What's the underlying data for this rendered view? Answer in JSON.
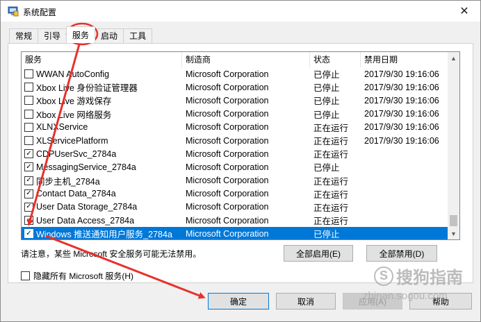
{
  "window": {
    "title": "系统配置",
    "close": "✕"
  },
  "tabs": [
    "常规",
    "引导",
    "服务",
    "启动",
    "工具"
  ],
  "table": {
    "headers": [
      "服务",
      "制造商",
      "状态",
      "禁用日期"
    ],
    "rows": [
      {
        "checked": false,
        "name": "WWAN AutoConfig",
        "maker": "Microsoft Corporation",
        "status": "已停止",
        "date": "2017/9/30 19:16:06"
      },
      {
        "checked": false,
        "name": "Xbox Live 身份验证管理器",
        "maker": "Microsoft Corporation",
        "status": "已停止",
        "date": "2017/9/30 19:16:06"
      },
      {
        "checked": false,
        "name": "Xbox Live 游戏保存",
        "maker": "Microsoft Corporation",
        "status": "已停止",
        "date": "2017/9/30 19:16:06"
      },
      {
        "checked": false,
        "name": "Xbox Live 网络服务",
        "maker": "Microsoft Corporation",
        "status": "已停止",
        "date": "2017/9/30 19:16:06"
      },
      {
        "checked": false,
        "name": "XLNXService",
        "maker": "Microsoft Corporation",
        "status": "正在运行",
        "date": "2017/9/30 19:16:06"
      },
      {
        "checked": false,
        "name": "XLServicePlatform",
        "maker": "Microsoft Corporation",
        "status": "正在运行",
        "date": "2017/9/30 19:16:06"
      },
      {
        "checked": true,
        "name": "CDPUserSvc_2784a",
        "maker": "Microsoft Corporation",
        "status": "正在运行",
        "date": ""
      },
      {
        "checked": true,
        "name": "MessagingService_2784a",
        "maker": "Microsoft Corporation",
        "status": "已停止",
        "date": ""
      },
      {
        "checked": true,
        "name": "同步主机_2784a",
        "maker": "Microsoft Corporation",
        "status": "正在运行",
        "date": ""
      },
      {
        "checked": true,
        "name": "Contact Data_2784a",
        "maker": "Microsoft Corporation",
        "status": "正在运行",
        "date": ""
      },
      {
        "checked": true,
        "name": "User Data Storage_2784a",
        "maker": "Microsoft Corporation",
        "status": "正在运行",
        "date": ""
      },
      {
        "checked": true,
        "name": "User Data Access_2784a",
        "maker": "Microsoft Corporation",
        "status": "正在运行",
        "date": ""
      },
      {
        "checked": true,
        "name": "Windows 推送通知用户服务_2784a",
        "maker": "Microsoft Corporation",
        "status": "已停止",
        "date": "",
        "selected": true
      }
    ]
  },
  "notice": "请注意，某些 Microsoft 安全服务可能无法禁用。",
  "buttons": {
    "enable_all": "全部启用(E)",
    "disable_all": "全部禁用(D)",
    "ok": "确定",
    "cancel": "取消",
    "apply": "应用(A)",
    "help": "帮助"
  },
  "hide_ms": "隐藏所有 Microsoft 服务(H)",
  "watermark": {
    "brand": "搜狗指南",
    "url": "zhinan.sogou.com"
  },
  "colors": {
    "selection": "#0078d7",
    "annotation": "#e8302a"
  },
  "icons": {
    "scroll_up": "▲",
    "scroll_down": "▼",
    "check": "✓"
  }
}
